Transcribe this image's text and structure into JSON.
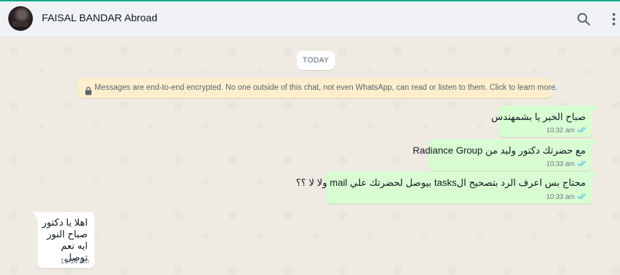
{
  "header": {
    "contact_name": "FAISAL BANDAR Abroad",
    "icons": {
      "search": "search-icon",
      "menu": "menu-icon"
    }
  },
  "chat": {
    "date_chip": "TODAY",
    "encryption_notice": "Messages are end-to-end encrypted. No one outside of this chat, not even WhatsApp, can read or listen to them. Click to learn more.",
    "messages": [
      {
        "direction": "out",
        "text": "صباح الخير يا بشمهندس",
        "time": "10:32 am",
        "status": "read"
      },
      {
        "direction": "out",
        "text": "مع حضرتك دكتور وليد من Radiance Group",
        "time": "10:33 am",
        "status": "read"
      },
      {
        "direction": "out",
        "text": "محتاج بس اعرف الرد بتصحيح الtasks بيوصل لحضرتك علي mail ولا لا ؟؟",
        "time": "10:33 am",
        "status": "read"
      },
      {
        "direction": "in",
        "text": "اهلا يا دكتور\nصباح النور\nايه نعم توصل",
        "time": "10:34 am"
      }
    ]
  },
  "colors": {
    "accent": "#00a884",
    "outgoing_bubble": "#d9fdd3",
    "incoming_bubble": "#ffffff",
    "read_ticks": "#53bdeb",
    "encryption_bg": "#ffeecd"
  }
}
